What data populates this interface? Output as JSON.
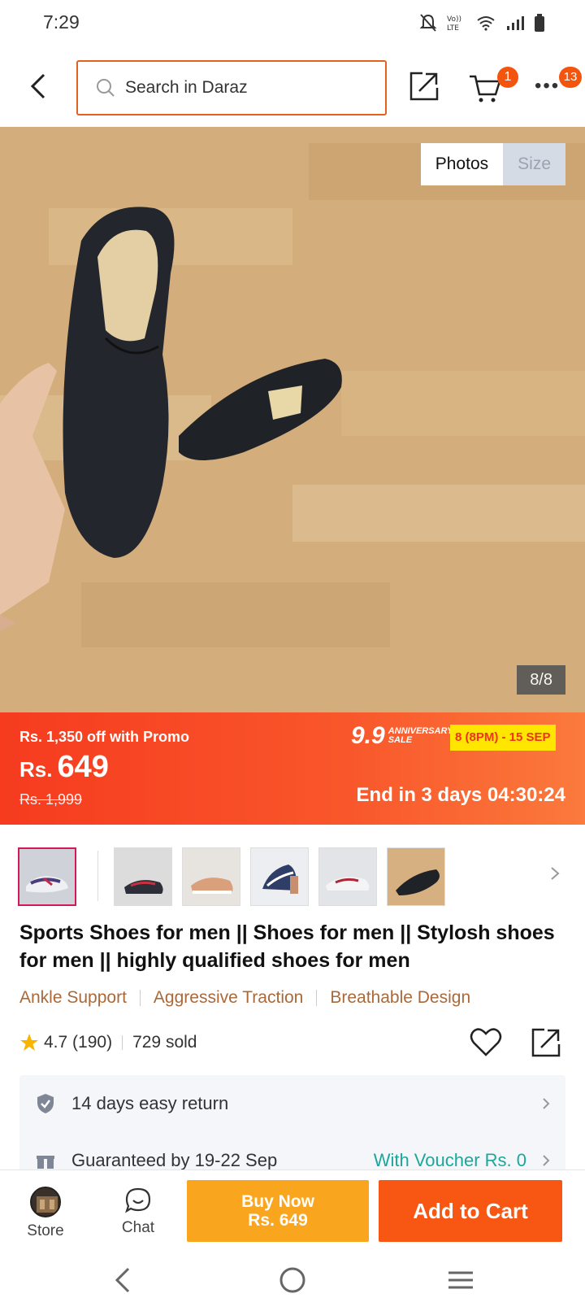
{
  "status_bar": {
    "time": "7:29"
  },
  "header": {
    "search_placeholder": "Search in Daraz",
    "cart_count": "1",
    "more_badge": "13"
  },
  "gallery": {
    "tabs": [
      "Photos",
      "Size"
    ],
    "counter": "8/8"
  },
  "promo": {
    "discount_text": "Rs. 1,350 off with Promo",
    "currency": "Rs.",
    "price": "649",
    "old_price": "Rs. 1,999",
    "sale_number": "9.9",
    "sale_line1": "ANNIVERSARY",
    "sale_line2": "SALE",
    "sale_dates": "8 (8PM) - 15 SEP",
    "countdown": "End in 3 days 04:30:24"
  },
  "product": {
    "title": "Sports Shoes for men || Shoes for men || Stylosh shoes for men || highly qualified shoes for men",
    "tags": [
      "Ankle Support",
      "Aggressive Traction",
      "Breathable Design"
    ],
    "rating": "4.7",
    "reviews": "(190)",
    "sold": "729 sold"
  },
  "services": {
    "return_text": "14 days easy return",
    "delivery_text": "Guaranteed by 19-22 Sep",
    "voucher_text": "With Voucher Rs. 0"
  },
  "actions": {
    "store_label": "Store",
    "chat_label": "Chat",
    "buy_now_line1": "Buy Now",
    "buy_now_line2": "Rs. 649",
    "add_to_cart_label": "Add to Cart"
  },
  "colors": {
    "accent": "#f75712",
    "buy_now": "#f9a51e",
    "tag_text": "#a9693a",
    "voucher_text": "#1aa89b",
    "badge": "#f4550e"
  }
}
